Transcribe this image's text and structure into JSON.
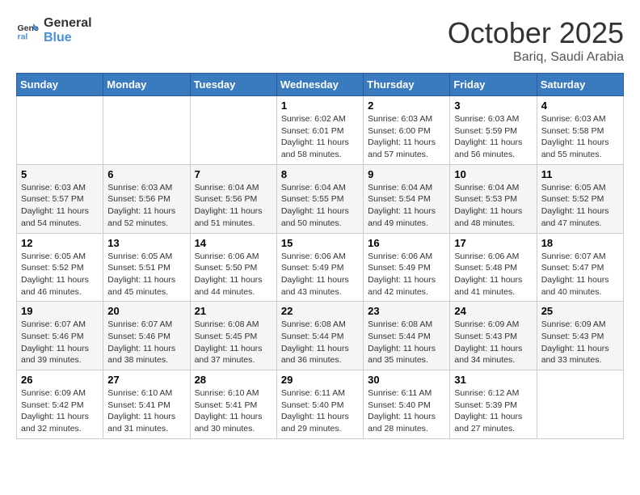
{
  "header": {
    "logo_line1": "General",
    "logo_line2": "Blue",
    "month": "October 2025",
    "location": "Bariq, Saudi Arabia"
  },
  "weekdays": [
    "Sunday",
    "Monday",
    "Tuesday",
    "Wednesday",
    "Thursday",
    "Friday",
    "Saturday"
  ],
  "weeks": [
    [
      {
        "day": "",
        "info": ""
      },
      {
        "day": "",
        "info": ""
      },
      {
        "day": "",
        "info": ""
      },
      {
        "day": "1",
        "info": "Sunrise: 6:02 AM\nSunset: 6:01 PM\nDaylight: 11 hours and 58 minutes."
      },
      {
        "day": "2",
        "info": "Sunrise: 6:03 AM\nSunset: 6:00 PM\nDaylight: 11 hours and 57 minutes."
      },
      {
        "day": "3",
        "info": "Sunrise: 6:03 AM\nSunset: 5:59 PM\nDaylight: 11 hours and 56 minutes."
      },
      {
        "day": "4",
        "info": "Sunrise: 6:03 AM\nSunset: 5:58 PM\nDaylight: 11 hours and 55 minutes."
      }
    ],
    [
      {
        "day": "5",
        "info": "Sunrise: 6:03 AM\nSunset: 5:57 PM\nDaylight: 11 hours and 54 minutes."
      },
      {
        "day": "6",
        "info": "Sunrise: 6:03 AM\nSunset: 5:56 PM\nDaylight: 11 hours and 52 minutes."
      },
      {
        "day": "7",
        "info": "Sunrise: 6:04 AM\nSunset: 5:56 PM\nDaylight: 11 hours and 51 minutes."
      },
      {
        "day": "8",
        "info": "Sunrise: 6:04 AM\nSunset: 5:55 PM\nDaylight: 11 hours and 50 minutes."
      },
      {
        "day": "9",
        "info": "Sunrise: 6:04 AM\nSunset: 5:54 PM\nDaylight: 11 hours and 49 minutes."
      },
      {
        "day": "10",
        "info": "Sunrise: 6:04 AM\nSunset: 5:53 PM\nDaylight: 11 hours and 48 minutes."
      },
      {
        "day": "11",
        "info": "Sunrise: 6:05 AM\nSunset: 5:52 PM\nDaylight: 11 hours and 47 minutes."
      }
    ],
    [
      {
        "day": "12",
        "info": "Sunrise: 6:05 AM\nSunset: 5:52 PM\nDaylight: 11 hours and 46 minutes."
      },
      {
        "day": "13",
        "info": "Sunrise: 6:05 AM\nSunset: 5:51 PM\nDaylight: 11 hours and 45 minutes."
      },
      {
        "day": "14",
        "info": "Sunrise: 6:06 AM\nSunset: 5:50 PM\nDaylight: 11 hours and 44 minutes."
      },
      {
        "day": "15",
        "info": "Sunrise: 6:06 AM\nSunset: 5:49 PM\nDaylight: 11 hours and 43 minutes."
      },
      {
        "day": "16",
        "info": "Sunrise: 6:06 AM\nSunset: 5:49 PM\nDaylight: 11 hours and 42 minutes."
      },
      {
        "day": "17",
        "info": "Sunrise: 6:06 AM\nSunset: 5:48 PM\nDaylight: 11 hours and 41 minutes."
      },
      {
        "day": "18",
        "info": "Sunrise: 6:07 AM\nSunset: 5:47 PM\nDaylight: 11 hours and 40 minutes."
      }
    ],
    [
      {
        "day": "19",
        "info": "Sunrise: 6:07 AM\nSunset: 5:46 PM\nDaylight: 11 hours and 39 minutes."
      },
      {
        "day": "20",
        "info": "Sunrise: 6:07 AM\nSunset: 5:46 PM\nDaylight: 11 hours and 38 minutes."
      },
      {
        "day": "21",
        "info": "Sunrise: 6:08 AM\nSunset: 5:45 PM\nDaylight: 11 hours and 37 minutes."
      },
      {
        "day": "22",
        "info": "Sunrise: 6:08 AM\nSunset: 5:44 PM\nDaylight: 11 hours and 36 minutes."
      },
      {
        "day": "23",
        "info": "Sunrise: 6:08 AM\nSunset: 5:44 PM\nDaylight: 11 hours and 35 minutes."
      },
      {
        "day": "24",
        "info": "Sunrise: 6:09 AM\nSunset: 5:43 PM\nDaylight: 11 hours and 34 minutes."
      },
      {
        "day": "25",
        "info": "Sunrise: 6:09 AM\nSunset: 5:43 PM\nDaylight: 11 hours and 33 minutes."
      }
    ],
    [
      {
        "day": "26",
        "info": "Sunrise: 6:09 AM\nSunset: 5:42 PM\nDaylight: 11 hours and 32 minutes."
      },
      {
        "day": "27",
        "info": "Sunrise: 6:10 AM\nSunset: 5:41 PM\nDaylight: 11 hours and 31 minutes."
      },
      {
        "day": "28",
        "info": "Sunrise: 6:10 AM\nSunset: 5:41 PM\nDaylight: 11 hours and 30 minutes."
      },
      {
        "day": "29",
        "info": "Sunrise: 6:11 AM\nSunset: 5:40 PM\nDaylight: 11 hours and 29 minutes."
      },
      {
        "day": "30",
        "info": "Sunrise: 6:11 AM\nSunset: 5:40 PM\nDaylight: 11 hours and 28 minutes."
      },
      {
        "day": "31",
        "info": "Sunrise: 6:12 AM\nSunset: 5:39 PM\nDaylight: 11 hours and 27 minutes."
      },
      {
        "day": "",
        "info": ""
      }
    ]
  ]
}
